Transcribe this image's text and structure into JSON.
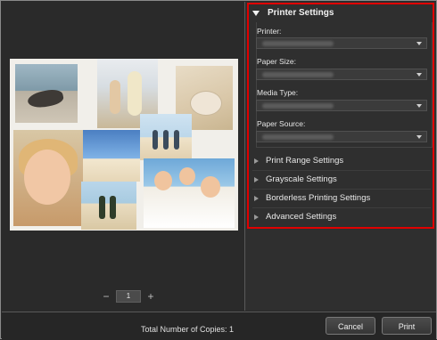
{
  "preview": {
    "page_number": "1",
    "prev_symbol": "−",
    "next_symbol": "+"
  },
  "settings": {
    "printer_settings": {
      "title": "Printer Settings",
      "fields": [
        {
          "label": "Printer:"
        },
        {
          "label": "Paper Size:"
        },
        {
          "label": "Media Type:"
        },
        {
          "label": "Paper Source:"
        }
      ]
    },
    "sections": [
      {
        "label": "Print Range Settings"
      },
      {
        "label": "Grayscale Settings"
      },
      {
        "label": "Borderless Printing Settings"
      },
      {
        "label": "Advanced Settings"
      }
    ]
  },
  "footer": {
    "copies_text": "Total Number of Copies:  1",
    "cancel_label": "Cancel",
    "print_label": "Print"
  },
  "colors": {
    "highlight_border": "#e00000"
  }
}
